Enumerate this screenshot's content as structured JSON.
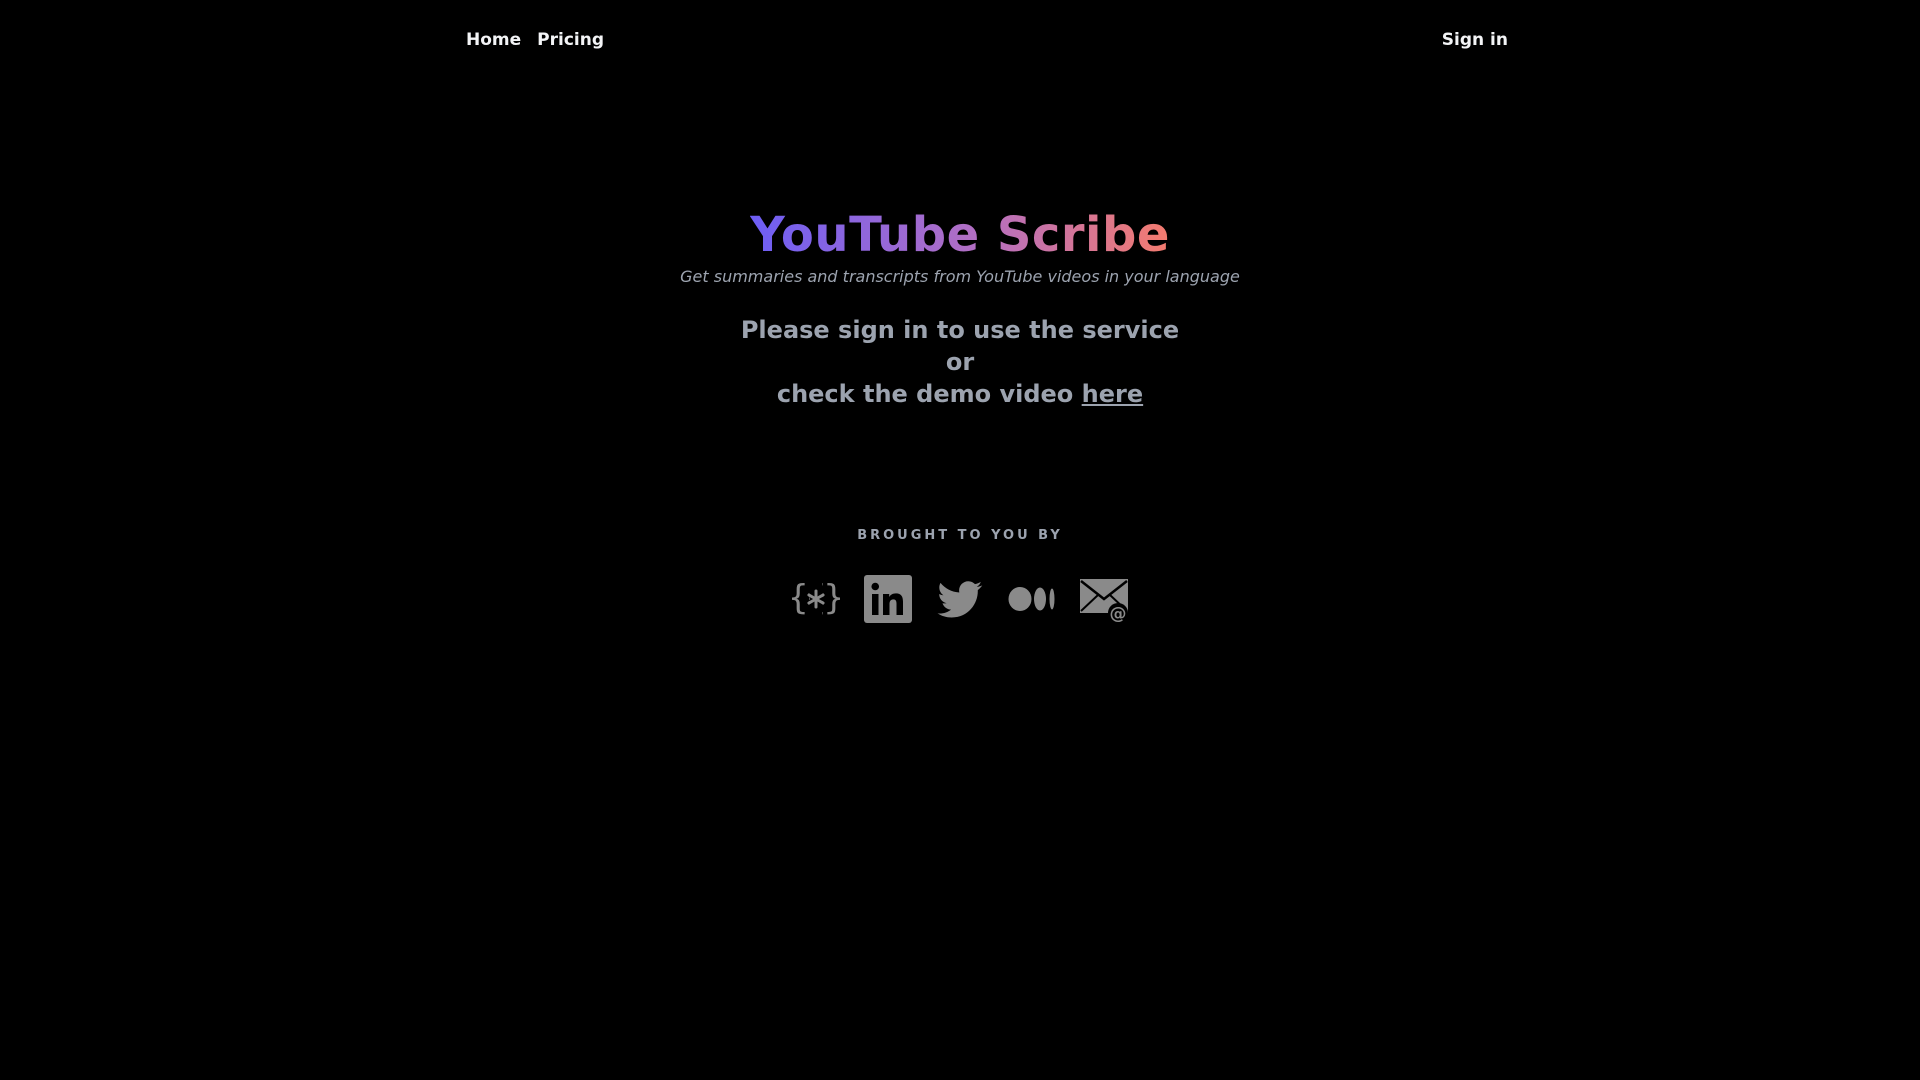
{
  "nav": {
    "home_label": "Home",
    "pricing_label": "Pricing",
    "signin_label": "Sign in"
  },
  "hero": {
    "title": "YouTube Scribe",
    "subtitle": "Get summaries and transcripts from YouTube videos in your language",
    "message_line1": "Please sign in to use the service",
    "message_line2": "or",
    "message_line3_prefix": "check the demo video ",
    "message_link": "here"
  },
  "footer": {
    "brought_by": "BROUGHT TO YOU BY",
    "icons": [
      "code-braces-icon",
      "linkedin-icon",
      "twitter-icon",
      "medium-icon",
      "email-icon"
    ]
  },
  "colors": {
    "background": "#000000",
    "text_muted": "#9ca3af",
    "icon_gray": "#8a8a8a",
    "gradient_start": "#6d5ef5",
    "gradient_end": "#f47b6e"
  }
}
